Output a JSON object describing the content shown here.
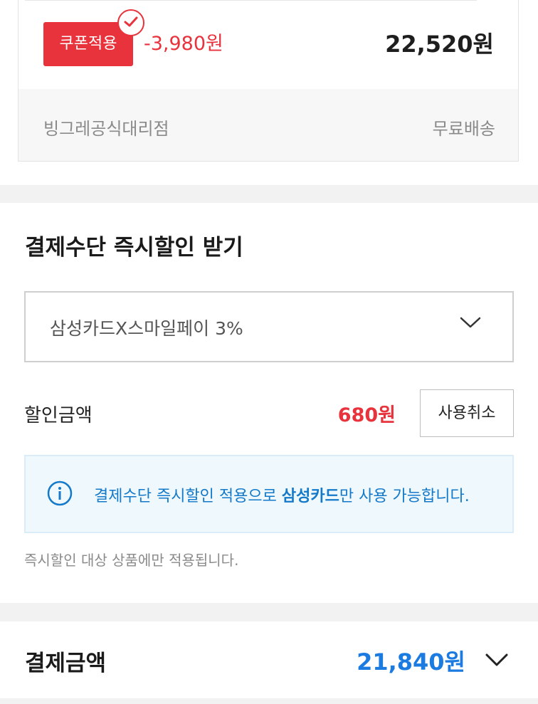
{
  "order_item": {
    "coupon_badge": "쿠폰적용",
    "coupon_discount": "-3,980원",
    "price": "22,520원",
    "seller": "빙그레공식대리점",
    "shipping": "무료배송"
  },
  "payment_discount": {
    "title": "결제수단 즉시할인 받기",
    "selected_card": "삼성카드X스마일페이 3%",
    "discount_label": "할인금액",
    "discount_amount": "680원",
    "cancel_label": "사용취소",
    "info_prefix": "결제수단 즉시할인 적용으로 ",
    "info_emphasis": "삼성카드",
    "info_suffix": "만 사용 가능합니다.",
    "note": "즉시할인 대상 상품에만 적용됩니다."
  },
  "total": {
    "label": "결제금액",
    "amount": "21,840원"
  },
  "colors": {
    "accent_red": "#e8323c",
    "accent_blue": "#1b7be0",
    "info_blue": "#1479c9"
  }
}
